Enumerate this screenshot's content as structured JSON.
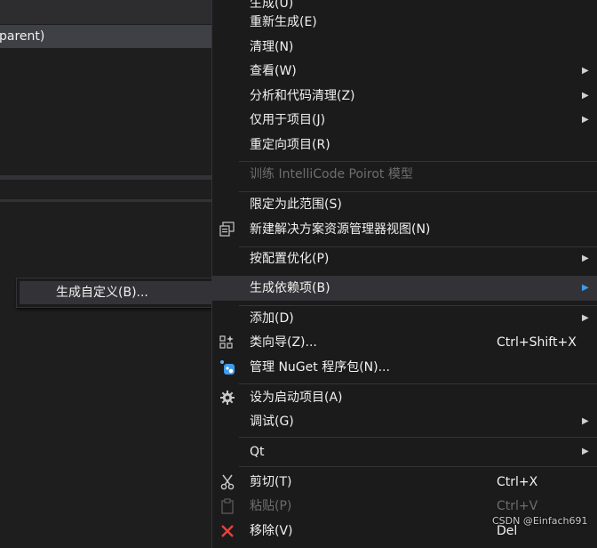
{
  "left_panel": {
    "selected_row": "parent)"
  },
  "submenu": {
    "item": "生成自定义(B)..."
  },
  "menu": {
    "items": [
      {
        "label": "生成(U)"
      },
      {
        "label": "重新生成(E)"
      },
      {
        "label": "清理(N)"
      },
      {
        "label": "查看(W)",
        "arrow": "▶"
      },
      {
        "label": "分析和代码清理(Z)",
        "arrow": "▶"
      },
      {
        "label": "仅用于项目(J)",
        "arrow": "▶"
      },
      {
        "label": "重定向项目(R)"
      },
      {
        "label": "训练 IntelliCode Poirot 模型"
      },
      {
        "label": "限定为此范围(S)"
      },
      {
        "label": "新建解决方案资源管理器视图(N)"
      },
      {
        "label": "按配置优化(P)",
        "arrow": "▶"
      },
      {
        "label": "生成依赖项(B)",
        "arrow": "▶"
      },
      {
        "label": "添加(D)",
        "arrow": "▶"
      },
      {
        "label": "类向导(Z)...",
        "shortcut": "Ctrl+Shift+X"
      },
      {
        "label": "管理 NuGet 程序包(N)..."
      },
      {
        "label": "设为启动项目(A)"
      },
      {
        "label": "调试(G)",
        "arrow": "▶"
      },
      {
        "label": "Qt",
        "arrow": "▶"
      },
      {
        "label": "剪切(T)",
        "shortcut": "Ctrl+X"
      },
      {
        "label": "粘贴(P)",
        "shortcut": "Ctrl+V"
      },
      {
        "label": "移除(V)",
        "shortcut": "Del"
      }
    ]
  },
  "watermark": "CSDN @Einfach691",
  "colors": {
    "menu_bg": "#1b1b1c",
    "highlight": "#333337",
    "accent": "#3d9cf0",
    "disabled": "#6d6d6d"
  }
}
